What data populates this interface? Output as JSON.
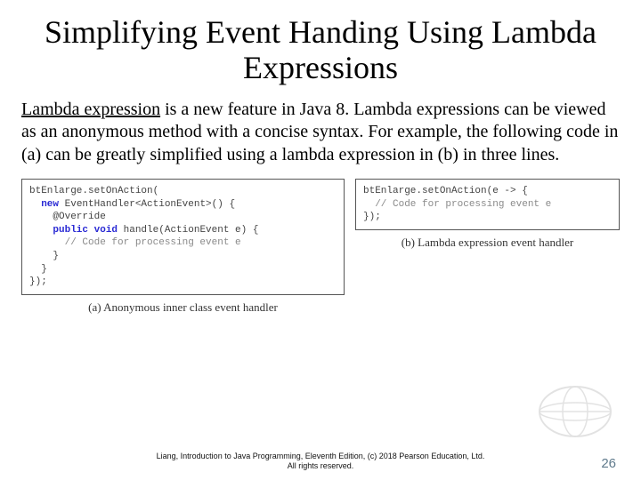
{
  "title": "Simplifying Event Handing Using Lambda Expressions",
  "body": {
    "lead": "Lambda expression",
    "rest": " is a new feature in Java 8. Lambda expressions can be viewed as an anonymous method with a concise syntax. For example, the following code in (a) can be greatly simplified using a lambda expression in (b) in three lines."
  },
  "code": {
    "a": {
      "l1": "btEnlarge.setOnAction(",
      "l2_kw": "new",
      "l2_rest": " EventHandler<ActionEvent>() {",
      "l3": "@Override",
      "l4_kw": "public void",
      "l4_rest": " handle(ActionEvent e) {",
      "l5_cmt": "// Code for processing event e",
      "l6": "}",
      "l7": "}",
      "l8": "});"
    },
    "b": {
      "l1": "btEnlarge.setOnAction(e -> {",
      "l2_cmt": "// Code for processing event e",
      "l3": "});"
    }
  },
  "captions": {
    "a": "(a) Anonymous inner class event handler",
    "b": "(b) Lambda expression event handler"
  },
  "footer": {
    "line1": "Liang, Introduction to Java Programming, Eleventh Edition, (c) 2018 Pearson Education, Ltd.",
    "line2": "All rights reserved."
  },
  "page_number": "26"
}
